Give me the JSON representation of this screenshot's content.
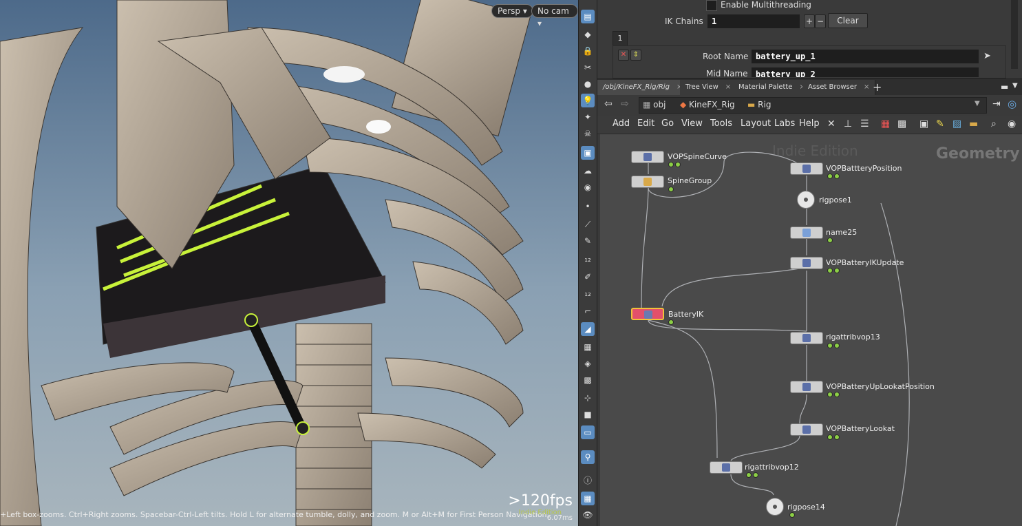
{
  "viewport": {
    "persp_label": "Persp",
    "cam_label": "No cam",
    "status": "+Left box-zooms. Ctrl+Right zooms. Spacebar-Ctrl-Left tilts. Hold L for alternate tumble, dolly, and zoom.      M or Alt+M for First Person Navigation.",
    "fps": ">120fps",
    "frame_time": "6.07ms",
    "watermark": "Indie Edition"
  },
  "params": {
    "multithread_label": "Enable Multithreading",
    "ikchains_label": "IK Chains",
    "ikchains_value": "1",
    "plus": "+",
    "minus": "−",
    "clear_label": "Clear",
    "tab_index": "1",
    "root_name_label": "Root Name",
    "root_name_value": "battery_up_1",
    "mid_name_label": "Mid Name",
    "mid_name_value": "battery_up_2"
  },
  "tabs": [
    {
      "label": "/obj/KineFX_Rig/Rig"
    },
    {
      "label": "Tree View"
    },
    {
      "label": "Material Palette"
    },
    {
      "label": "Asset Browser"
    }
  ],
  "path": {
    "obj": "obj",
    "kinefx": "KineFX_Rig",
    "rig": "Rig"
  },
  "menu": [
    "Add",
    "Edit",
    "Go",
    "View",
    "Tools",
    "Layout",
    "Labs",
    "Help"
  ],
  "network": {
    "watermark": "Indie Edition",
    "context_label": "Geometry",
    "nodes": [
      {
        "label": "VOPSpineCurve"
      },
      {
        "label": "SpineGroup"
      },
      {
        "label": "BatteryIK"
      },
      {
        "label": "VOPBattteryPosition"
      },
      {
        "label": "rigpose1"
      },
      {
        "label": "name25"
      },
      {
        "label": "VOPBatteryIKUpdate"
      },
      {
        "label": "rigattribvop13"
      },
      {
        "label": "VOPBatteryUpLookatPosition"
      },
      {
        "label": "VOPBatteryLookat"
      },
      {
        "label": "rigattribvop12"
      },
      {
        "label": "rigpose14"
      }
    ]
  }
}
